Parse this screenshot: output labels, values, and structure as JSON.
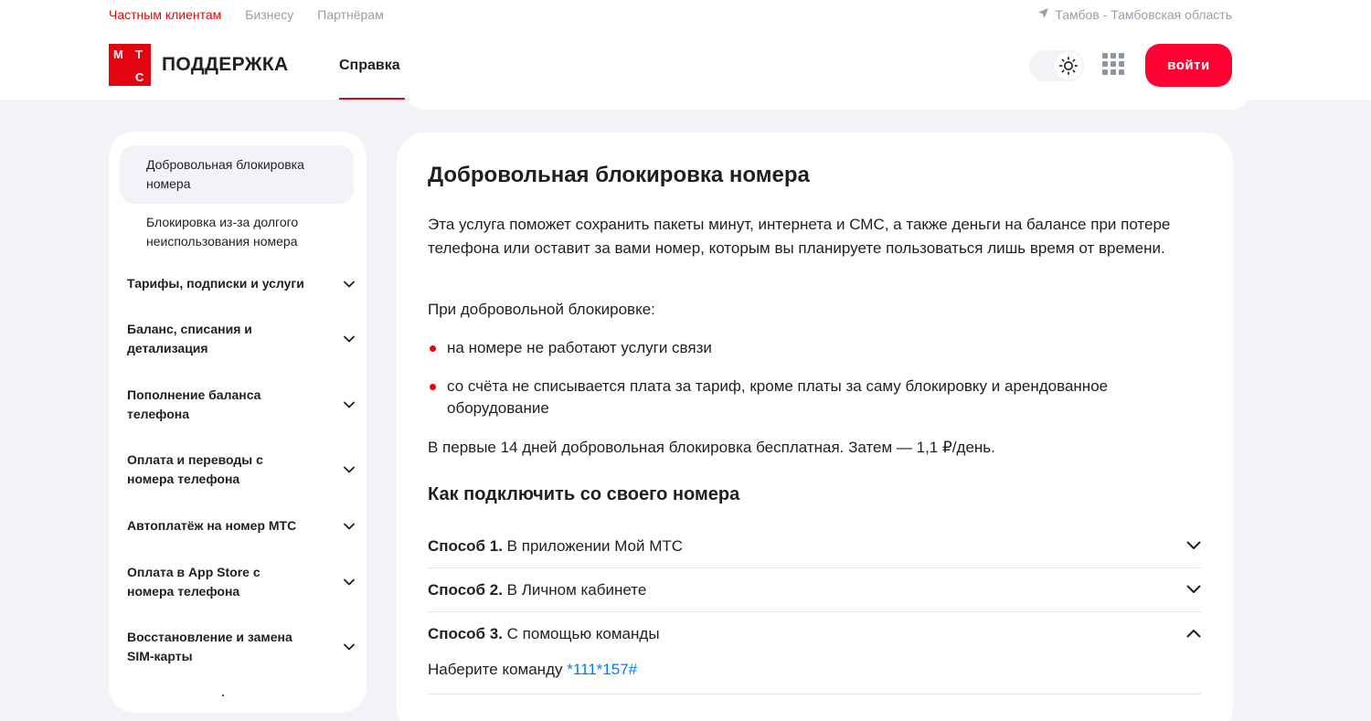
{
  "topnav": {
    "items": [
      "Частным клиентам",
      "Бизнесу",
      "Партнёрам"
    ],
    "active_index": 0
  },
  "region": {
    "label": "Тамбов - Тамбовская область",
    "icon": "location-arrow-icon"
  },
  "logo": {
    "letters": [
      "М",
      "Т",
      "С"
    ],
    "text": "ПОДДЕРЖКА"
  },
  "mainnav": {
    "item": "Справка"
  },
  "header_actions": {
    "theme_icon": "sun-icon",
    "apps_icon": "apps-grid-icon",
    "login_label": "войти"
  },
  "sidebar": {
    "subitems": [
      {
        "label": "Добровольная блокировка номера",
        "active": true
      },
      {
        "label": "Блокировка из-за долгого неиспользования номера",
        "active": false
      }
    ],
    "categories": [
      "Тарифы, подписки и услуги",
      "Баланс, списания и детализация",
      "Пополнение баланса телефона",
      "Оплата и переводы с номера телефона",
      "Автоплатёж на номер МТС",
      "Оплата в App Store с номера телефона",
      "Восстановление и замена SIM-карты"
    ]
  },
  "article": {
    "title": "Добровольная блокировка номера",
    "intro": "Эта услуга поможет сохранить пакеты минут, интернета и СМС, а также деньги на балансе при потере телефона или оставит за вами номер, которым вы планируете пользоваться лишь время от времени.",
    "lead": "При добровольной блокировке:",
    "bullets": [
      "на номере не работают услуги связи",
      "со счёта не списывается плата за тариф, кроме платы за саму блокировку и арендованное оборудование"
    ],
    "pricing": "В первые 14 дней добровольная блокировка бесплатная. Затем — 1,1 ₽/день.",
    "subtitle": "Как подключить со своего номера",
    "methods": [
      {
        "num": "Способ 1.",
        "text": "В приложении Мой МТС",
        "expanded": false
      },
      {
        "num": "Способ 2.",
        "text": "В Личном кабинете",
        "expanded": false
      },
      {
        "num": "Способ 3.",
        "text": "С помощью команды",
        "expanded": true
      }
    ],
    "method3_body": {
      "prefix": "Наберите команду",
      "command": "*111*157#"
    }
  },
  "colors": {
    "brand_red": "#e30611",
    "button_red": "#ff0032",
    "link_blue": "#007cff",
    "page_bg": "#f2f3f7",
    "muted_text": "#969fa8"
  }
}
